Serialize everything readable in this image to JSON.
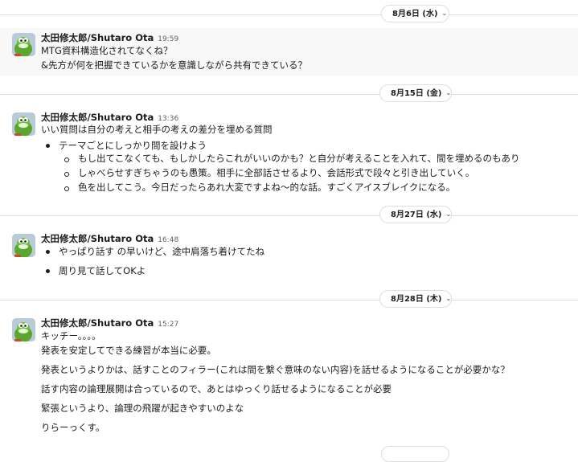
{
  "dividers": [
    {
      "label": "8月6日 (水)"
    },
    {
      "label": "8月15日 (金)"
    },
    {
      "label": "8月27日 (水)"
    },
    {
      "label": "8月28日 (木)"
    }
  ],
  "messages": [
    {
      "author": "太田修太郎/Shutaro Ota",
      "time": "19:59",
      "lines": [
        "MTG資料構造化されてなくね？",
        "&先方が何を把握できているかを意識しながら共有できている？"
      ]
    },
    {
      "author": "太田修太郎/Shutaro Ota",
      "time": "13:36",
      "lines": [
        "いい質問は自分の考えと相手の考えの差分を埋める質問",
        "テーマごとにしっかり間を設けよう",
        "もし出てこなくても、もしかしたらこれがいいのかも？と自分が考えることを入れて、間を埋めるのもあり",
        "しゃべらせすぎちゃうのも愚策。相手に全部話させるより、会話形式で段々と引き出していく。",
        "色を出してこう。今日だったらあれ大変ですよね〜的な話。すごくアイスブレイクになる。"
      ]
    },
    {
      "author": "太田修太郎/Shutaro Ota",
      "time": "16:48",
      "lines": [
        "やっぱり話す の早いけど、途中肩落ち着けてたね",
        "周り見て話してOKよ"
      ]
    },
    {
      "author": "太田修太郎/Shutaro Ota",
      "time": "15:27",
      "lines": [
        "キッチー。。。。",
        "発表を安定してできる練習が本当に必要。",
        "発表というよりかは、話すことのフィラー(これは間を繋ぐ意味のない内容)を話せるようになることが必要かな？",
        "話す内容の論理展開は合っているので、あとはゆっくり話せるようになることが必要",
        "緊張というより、論理の飛躍が起きやすいのよな",
        "りらーっくす。"
      ]
    }
  ]
}
